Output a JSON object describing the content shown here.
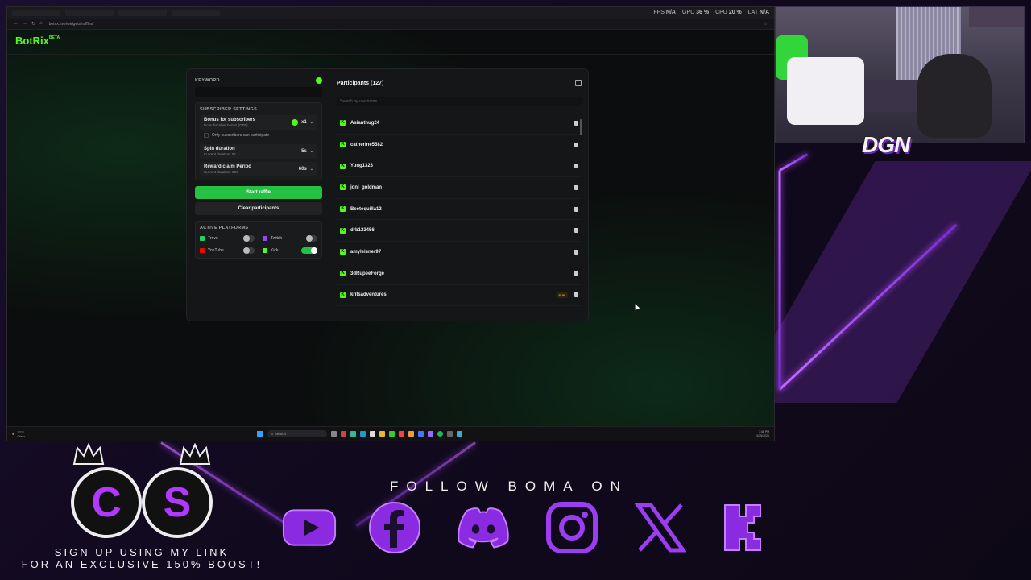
{
  "browser": {
    "url": "botrix.live/widgets/raffles/",
    "hud": {
      "fps_label": "FPS",
      "fps": "N/A",
      "gpu_label": "GPU",
      "gpu": "36 %",
      "cpu_label": "CPU",
      "cpu": "20 %",
      "lat_label": "LAT",
      "lat": "N/A"
    }
  },
  "brand": {
    "name": "BotRix",
    "tag": "BETA"
  },
  "raffle": {
    "keyword_label": "KEYWORD",
    "keyword_value": "",
    "subscriber_settings_label": "SUBSCRIBER SETTINGS",
    "bonus": {
      "title": "Bonus for subscribers",
      "sub": "No subscriber bonus (OFF)",
      "value": "x1"
    },
    "only_subs_label": "Only subscribers can participate",
    "spin": {
      "title": "Spin duration",
      "sub": "Current duration: 5s",
      "value": "5s"
    },
    "reward": {
      "title": "Reward claim Period",
      "sub": "Current duration: 60s",
      "value": "60s"
    },
    "start_label": "Start raffle",
    "clear_label": "Clear participants",
    "platforms_label": "ACTIVE PLATFORMS",
    "platforms": [
      {
        "name": "Trovo",
        "enabled": false,
        "color": "#19d66b"
      },
      {
        "name": "Twitch",
        "enabled": false,
        "color": "#9146ff"
      },
      {
        "name": "YouTube",
        "enabled": false,
        "color": "#ff0000"
      },
      {
        "name": "Kick",
        "enabled": true,
        "color": "#53fc18"
      }
    ]
  },
  "participants": {
    "title": "Participants (127)",
    "search_placeholder": "Search by username...",
    "list": [
      {
        "name": "Asianthug24",
        "badge": ""
      },
      {
        "name": "catherine5582",
        "badge": ""
      },
      {
        "name": "Yung1323",
        "badge": ""
      },
      {
        "name": "joni_goldman",
        "badge": ""
      },
      {
        "name": "Beetequilla12",
        "badge": ""
      },
      {
        "name": "drb123456",
        "badge": ""
      },
      {
        "name": "amyleisner97",
        "badge": ""
      },
      {
        "name": "3dRupeeForge",
        "badge": ""
      },
      {
        "name": "kritsadventures",
        "badge": "SUB"
      }
    ]
  },
  "taskbar": {
    "weather": "77°F",
    "weather_sub": "Clear",
    "search": "Search",
    "time": "7:48 PM",
    "date": "5/25/2026"
  },
  "overlay": {
    "webcam_name": "DGN",
    "cs_letters": [
      "C",
      "S"
    ],
    "signup_line1": "SIGN UP USING MY LINK",
    "signup_line2": "FOR AN EXCLUSIVE 150% BOOST!",
    "follow": "FOLLOW BOMA ON",
    "socials": [
      "youtube-icon",
      "facebook-icon",
      "discord-icon",
      "instagram-icon",
      "x-icon",
      "kick-icon"
    ]
  }
}
